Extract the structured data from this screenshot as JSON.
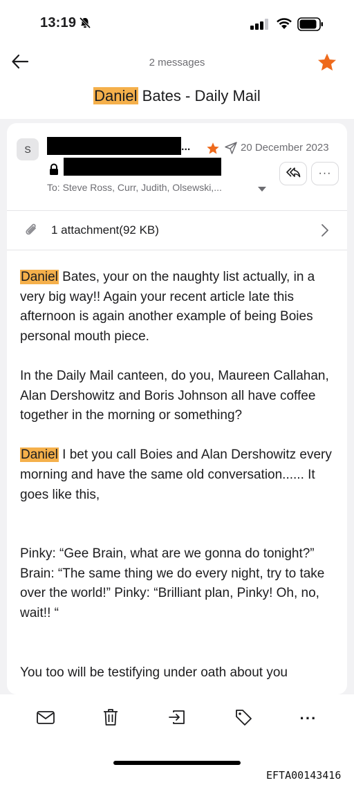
{
  "status_bar": {
    "time": "13:19"
  },
  "header": {
    "message_count": "2 messages",
    "title_highlight": "Daniel",
    "title_rest": " Bates - Daily Mail",
    "accent_color": "#ee6a1c"
  },
  "message": {
    "avatar_letter": "S",
    "sender_ellipsis": "...",
    "date": "20 December 2023",
    "recipients": "To: Steve Ross, Curr, Judith, Olsewski,...",
    "more_label": "···"
  },
  "attachment": {
    "label": "1 attachment(92 KB)"
  },
  "body": {
    "p1_highlight": "Daniel",
    "p1_rest": " Bates, your on the naughty list actually, in a very big way!! Again your recent article late this afternoon is again another example of being Boies personal mouth piece.",
    "p2": "In the Daily Mail canteen, do you, Maureen Callahan, Alan Dershowitz and Boris Johnson all have coffee together in the morning or something?",
    "p3_highlight": "Daniel",
    "p3_rest": " I bet you call Boies and Alan Dershowitz every morning and have the same old conversation...... It goes like this,",
    "p4": "Pinky: “Gee Brain, what are we gonna do tonight?” Brain: “The same thing we do every night, try to take over the world!” Pinky: “Brilliant plan, Pinky! Oh, no, wait!! “",
    "p5": "You too will be testifying under oath about you"
  },
  "toolbar": {
    "more_label": "···"
  },
  "footer": {
    "document_id": "EFTA00143416"
  }
}
